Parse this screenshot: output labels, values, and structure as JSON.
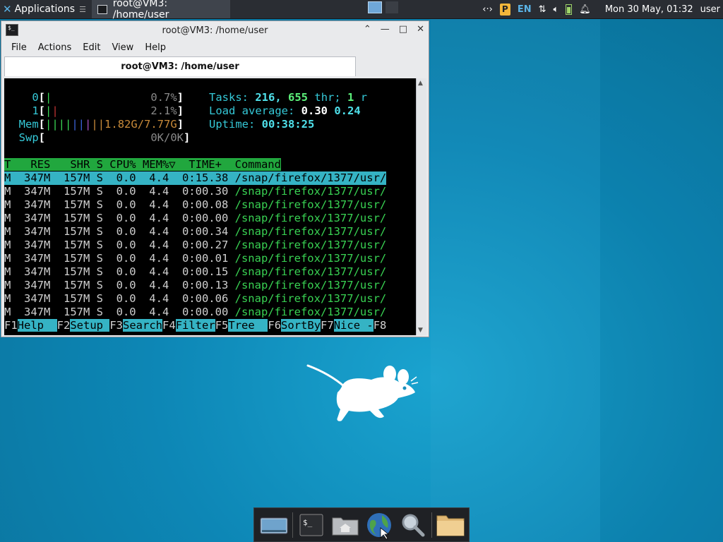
{
  "panel": {
    "apps_label": "Applications",
    "task_title": "root@VM3: /home/user",
    "lang": "EN",
    "clock": "Mon 30 May, 01:32",
    "user": "user"
  },
  "window": {
    "title": "root@VM3: /home/user",
    "tab_title": "root@VM3: /home/user",
    "menu": [
      "File",
      "Actions",
      "Edit",
      "View",
      "Help"
    ]
  },
  "htop": {
    "cpu0_label": "0",
    "cpu0_pct": "0.7%",
    "cpu1_label": "1",
    "cpu1_pct": "2.1%",
    "mem_label": "Mem",
    "mem_value": "1.82G/7.77G",
    "swp_label": "Swp",
    "swp_value": "0K/0K",
    "tasks_label": "Tasks:",
    "tasks_count": "216,",
    "threads": "655",
    "thr_label": "thr;",
    "running": "1",
    "running_label": "r",
    "load_label": "Load average:",
    "load1": "0.30",
    "load5": "0.24",
    "uptime_label": "Uptime:",
    "uptime": "00:38:25",
    "columns": [
      "T",
      "RES",
      "SHR",
      "S",
      "CPU%",
      "MEM%▽",
      "TIME+",
      "Command"
    ],
    "header_line": "T   RES   SHR S CPU% MEM%▽  TIME+  Command",
    "processes": [
      {
        "line_left": "M  347M  157M S  0.0  4.4  0:15.38 ",
        "cmd": "/snap/firefox/1377/usr/"
      },
      {
        "line_left": "M  347M  157M S  0.0  4.4  0:00.30 ",
        "cmd": "/snap/firefox/1377/usr/"
      },
      {
        "line_left": "M  347M  157M S  0.0  4.4  0:00.08 ",
        "cmd": "/snap/firefox/1377/usr/"
      },
      {
        "line_left": "M  347M  157M S  0.0  4.4  0:00.00 ",
        "cmd": "/snap/firefox/1377/usr/"
      },
      {
        "line_left": "M  347M  157M S  0.0  4.4  0:00.34 ",
        "cmd": "/snap/firefox/1377/usr/"
      },
      {
        "line_left": "M  347M  157M S  0.0  4.4  0:00.27 ",
        "cmd": "/snap/firefox/1377/usr/"
      },
      {
        "line_left": "M  347M  157M S  0.0  4.4  0:00.01 ",
        "cmd": "/snap/firefox/1377/usr/"
      },
      {
        "line_left": "M  347M  157M S  0.0  4.4  0:00.15 ",
        "cmd": "/snap/firefox/1377/usr/"
      },
      {
        "line_left": "M  347M  157M S  0.0  4.4  0:00.13 ",
        "cmd": "/snap/firefox/1377/usr/"
      },
      {
        "line_left": "M  347M  157M S  0.0  4.4  0:00.06 ",
        "cmd": "/snap/firefox/1377/usr/"
      },
      {
        "line_left": "M  347M  157M S  0.0  4.4  0:00.00 ",
        "cmd": "/snap/firefox/1377/usr/"
      }
    ],
    "fkeys": [
      {
        "key": "F1",
        "label": "Help  "
      },
      {
        "key": "F2",
        "label": "Setup "
      },
      {
        "key": "F3",
        "label": "Search"
      },
      {
        "key": "F4",
        "label": "Filter"
      },
      {
        "key": "F5",
        "label": "Tree  "
      },
      {
        "key": "F6",
        "label": "SortBy"
      },
      {
        "key": "F7",
        "label": "Nice -"
      },
      {
        "key": "F8",
        "label": ""
      }
    ]
  },
  "dock": {
    "items": [
      "show-desktop-icon",
      "terminal-icon",
      "home-folder-icon",
      "web-browser-icon",
      "search-icon",
      "folder-icon"
    ]
  }
}
